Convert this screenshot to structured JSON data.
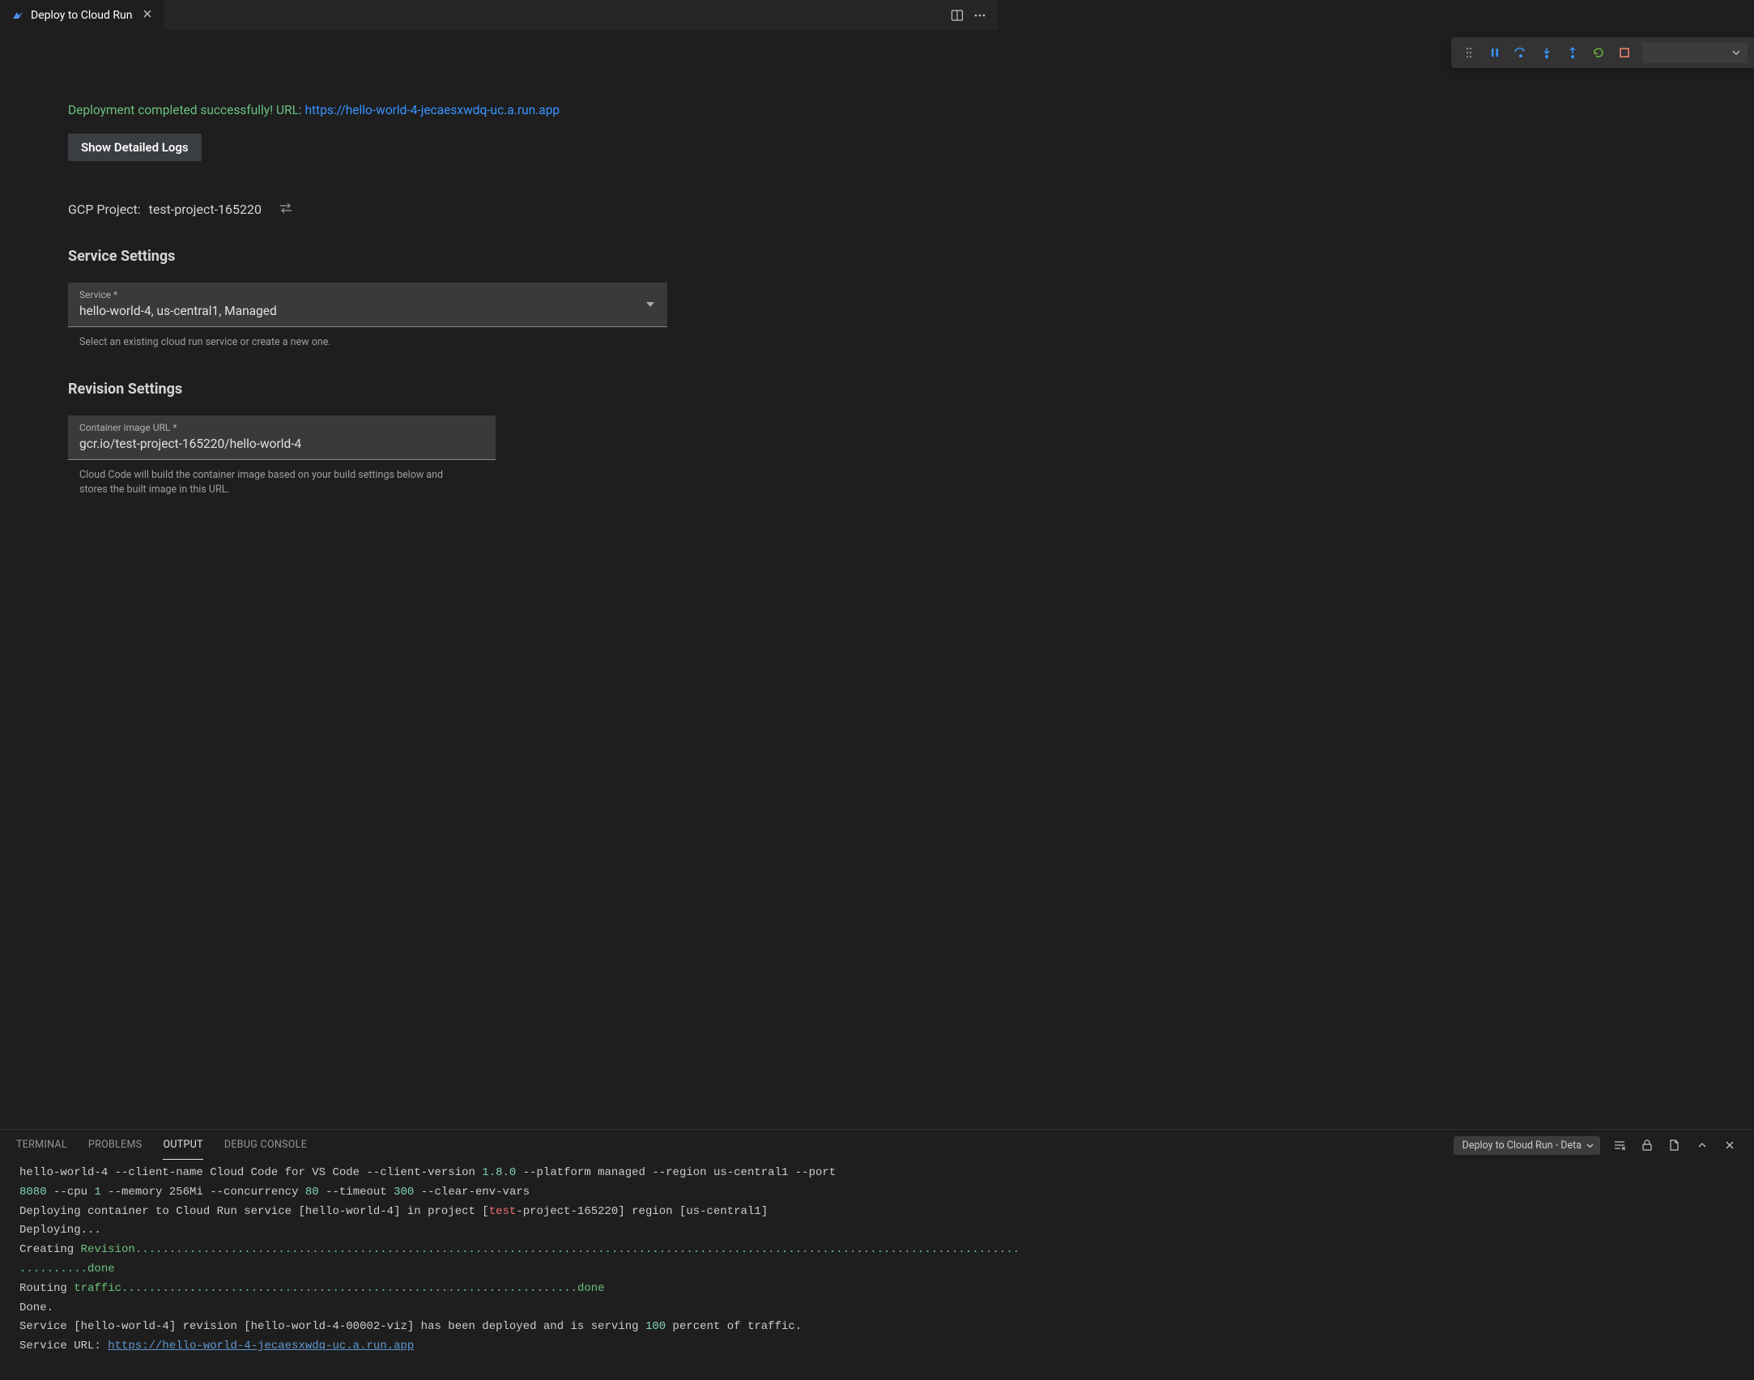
{
  "tab": {
    "title": "Deploy to Cloud Run"
  },
  "status": {
    "prefix": "Deployment completed successfully! URL: ",
    "url": "https://hello-world-4-jecaesxwdq-uc.a.run.app"
  },
  "buttons": {
    "show_detailed_logs": "Show Detailed Logs"
  },
  "gcp_project": {
    "label": "GCP Project:",
    "value": "test-project-165220"
  },
  "sections": {
    "service_settings": "Service Settings",
    "revision_settings": "Revision Settings"
  },
  "service_field": {
    "label": "Service *",
    "value": "hello-world-4, us-central1, Managed",
    "help": "Select an existing cloud run service or create a new one."
  },
  "container_field": {
    "label": "Container image URL *",
    "value": "gcr.io/test-project-165220/hello-world-4",
    "help": "Cloud Code will build the container image based on your build settings below and stores the built image in this URL."
  },
  "panel_tabs": {
    "terminal": "TERMINAL",
    "problems": "PROBLEMS",
    "output": "OUTPUT",
    "debug_console": "DEBUG CONSOLE"
  },
  "output_dropdown": "Deploy to Cloud Run - Deta",
  "terminal": {
    "line1_a": "hello-world-4 --client-name Cloud Code for VS Code --client-version ",
    "line1_v": "1.8.0",
    "line1_b": " --platform managed --region us-central1 --port",
    "line2_a": "8080",
    "line2_b": " --cpu ",
    "line2_c": "1",
    "line2_d": " --memory 256Mi --concurrency ",
    "line2_e": "80",
    "line2_f": " --timeout ",
    "line2_g": "300",
    "line2_h": " --clear-env-vars",
    "line3_a": "Deploying container to Cloud Run service [hello-world-4] in project [",
    "line3_b": "test",
    "line3_c": "-project-165220] region [us-central1]",
    "line4": "Deploying...",
    "line5_a": "Creating ",
    "line5_b": "Revision",
    "line5_dots": "..................................................................................................................................",
    "line6_dots": "..........",
    "line6_done": "done",
    "line7_a": "Routing ",
    "line7_b": "traffic",
    "line7_dots": "...................................................................",
    "line7_done": "done",
    "line8": "Done.",
    "line9_a": "Service [hello-world-4] revision [hello-world-4-00002-viz] has been deployed and is serving ",
    "line9_b": "100",
    "line9_c": " percent of traffic.",
    "line10_a": "Service URL: ",
    "line10_url": "https://hello-world-4-jecaesxwdq-uc.a.run.app"
  }
}
